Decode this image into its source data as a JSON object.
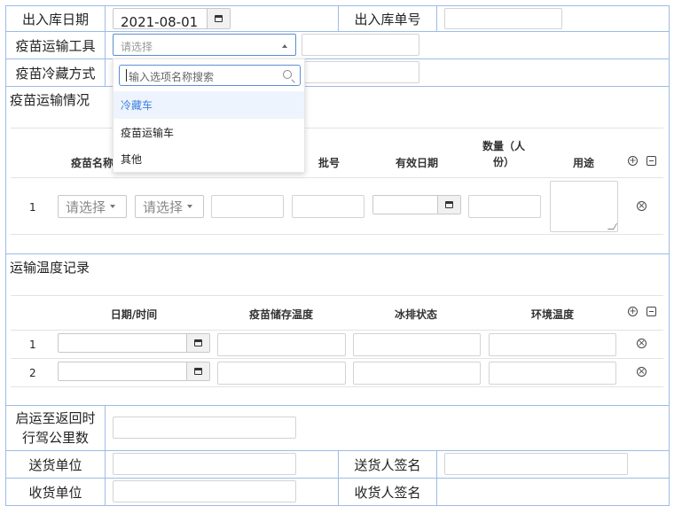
{
  "form": {
    "date_label": "出入库日期",
    "date_value": "2021-08-01",
    "order_no_label": "出入库单号",
    "order_no_value": "",
    "transport_tool_label": "疫苗运输工具",
    "transport_tool_placeholder": "请选择",
    "transport_tool_extra": "",
    "cold_method_label": "疫苗冷藏方式",
    "cold_method_extra": ""
  },
  "dropdown": {
    "search_placeholder": "输入选项名称搜索",
    "options": [
      "冷藏车",
      "疫苗运输车",
      "其他"
    ],
    "highlighted_index": 0
  },
  "transport_section": {
    "title": "疫苗运输情况",
    "headers": [
      "疫苗名称",
      "批号",
      "有效日期",
      "数量（人份）",
      "用途"
    ],
    "rows": [
      {
        "index": "1",
        "select1": "请选择",
        "select2": "请选择"
      }
    ]
  },
  "temperature_section": {
    "title": "运输温度记录",
    "headers": [
      "日期/时间",
      "疫苗储存温度",
      "冰排状态",
      "环境温度"
    ],
    "rows": [
      {
        "index": "1"
      },
      {
        "index": "2"
      }
    ]
  },
  "footer": {
    "mileage_label_line1": "启运至返回时",
    "mileage_label_line2": "行驾公里数",
    "sender_unit_label": "送货单位",
    "sender_sign_label": "送货人签名",
    "receiver_unit_label": "收货单位",
    "receiver_sign_label": "收货人签名"
  },
  "icons": [
    "add-circle-icon",
    "import-icon",
    "remove-circle-icon",
    "calendar-icon",
    "search-icon",
    "caret-up-icon",
    "caret-down-icon",
    "resize-grip-icon"
  ],
  "colors": {
    "border": "#9dbbe6",
    "highlight_bg": "#eef4fd",
    "highlight_text": "#3d7fe0",
    "focus_border": "#5b8fd6"
  }
}
